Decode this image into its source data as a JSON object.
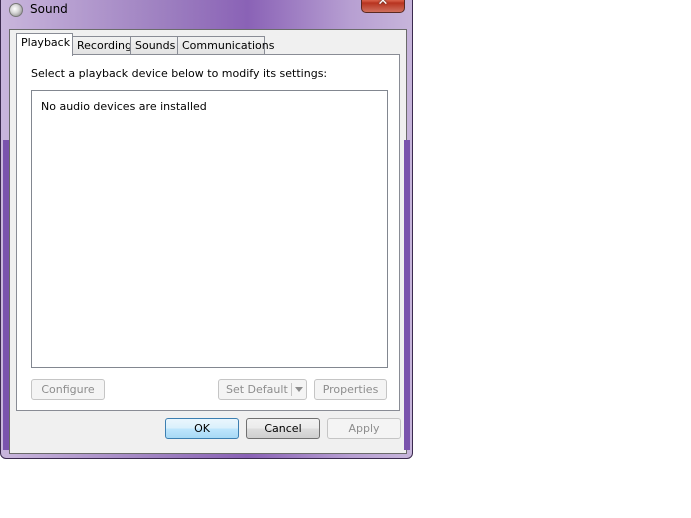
{
  "window": {
    "title": "Sound",
    "icon": "speaker-icon",
    "close_label": "✕"
  },
  "tabs": [
    {
      "label": "Playback",
      "active": true
    },
    {
      "label": "Recording",
      "active": false
    },
    {
      "label": "Sounds",
      "active": false
    },
    {
      "label": "Communications",
      "active": false
    }
  ],
  "playback": {
    "instruction": "Select a playback device below to modify its settings:",
    "empty_message": "No audio devices are installed",
    "configure_label": "Configure",
    "set_default_label": "Set Default",
    "properties_label": "Properties"
  },
  "footer": {
    "ok_label": "OK",
    "cancel_label": "Cancel",
    "apply_label": "Apply"
  }
}
